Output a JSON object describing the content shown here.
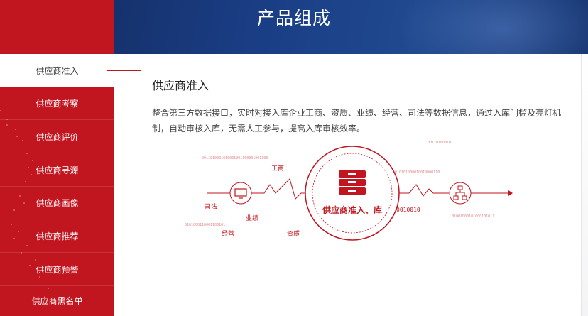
{
  "banner": {
    "title": "产品组成"
  },
  "sidebar": {
    "items": [
      {
        "label": "供应商准入",
        "active": true
      },
      {
        "label": "供应商考察",
        "active": false
      },
      {
        "label": "供应商评价",
        "active": false
      },
      {
        "label": "供应商寻源",
        "active": false
      },
      {
        "label": "供应商画像",
        "active": false
      },
      {
        "label": "供应商推荐",
        "active": false
      },
      {
        "label": "供应商预警",
        "active": false
      },
      {
        "label": "供应商黑名单",
        "active": false
      }
    ]
  },
  "content": {
    "title": "供应商准入",
    "description": "整合第三方数据接口，实时对接入库企业工商、资质、业绩、经营、司法等数据信息，通过入库门槛及亮灯机制，自动审核入库，无需人工参与，提高入库审核效率。"
  },
  "diagram": {
    "center_label": "供应商准入、库",
    "labels": {
      "gongshang": "工商",
      "sifa": "司法",
      "yeji": "业绩",
      "jingying": "经营",
      "zizhi": "资质"
    },
    "binary": {
      "top_left": "0011010001010001001100001001100",
      "top_right": "00110100010",
      "mid_right": "0010010",
      "small_a": "010101000010010000110",
      "small_b": "0101000110001100101",
      "small_c": "01001000101000101011"
    },
    "colors": {
      "accent": "#c1161f",
      "banner": "#1a3e86"
    },
    "icons": [
      "monitor-icon",
      "database-icon",
      "network-icon"
    ]
  }
}
